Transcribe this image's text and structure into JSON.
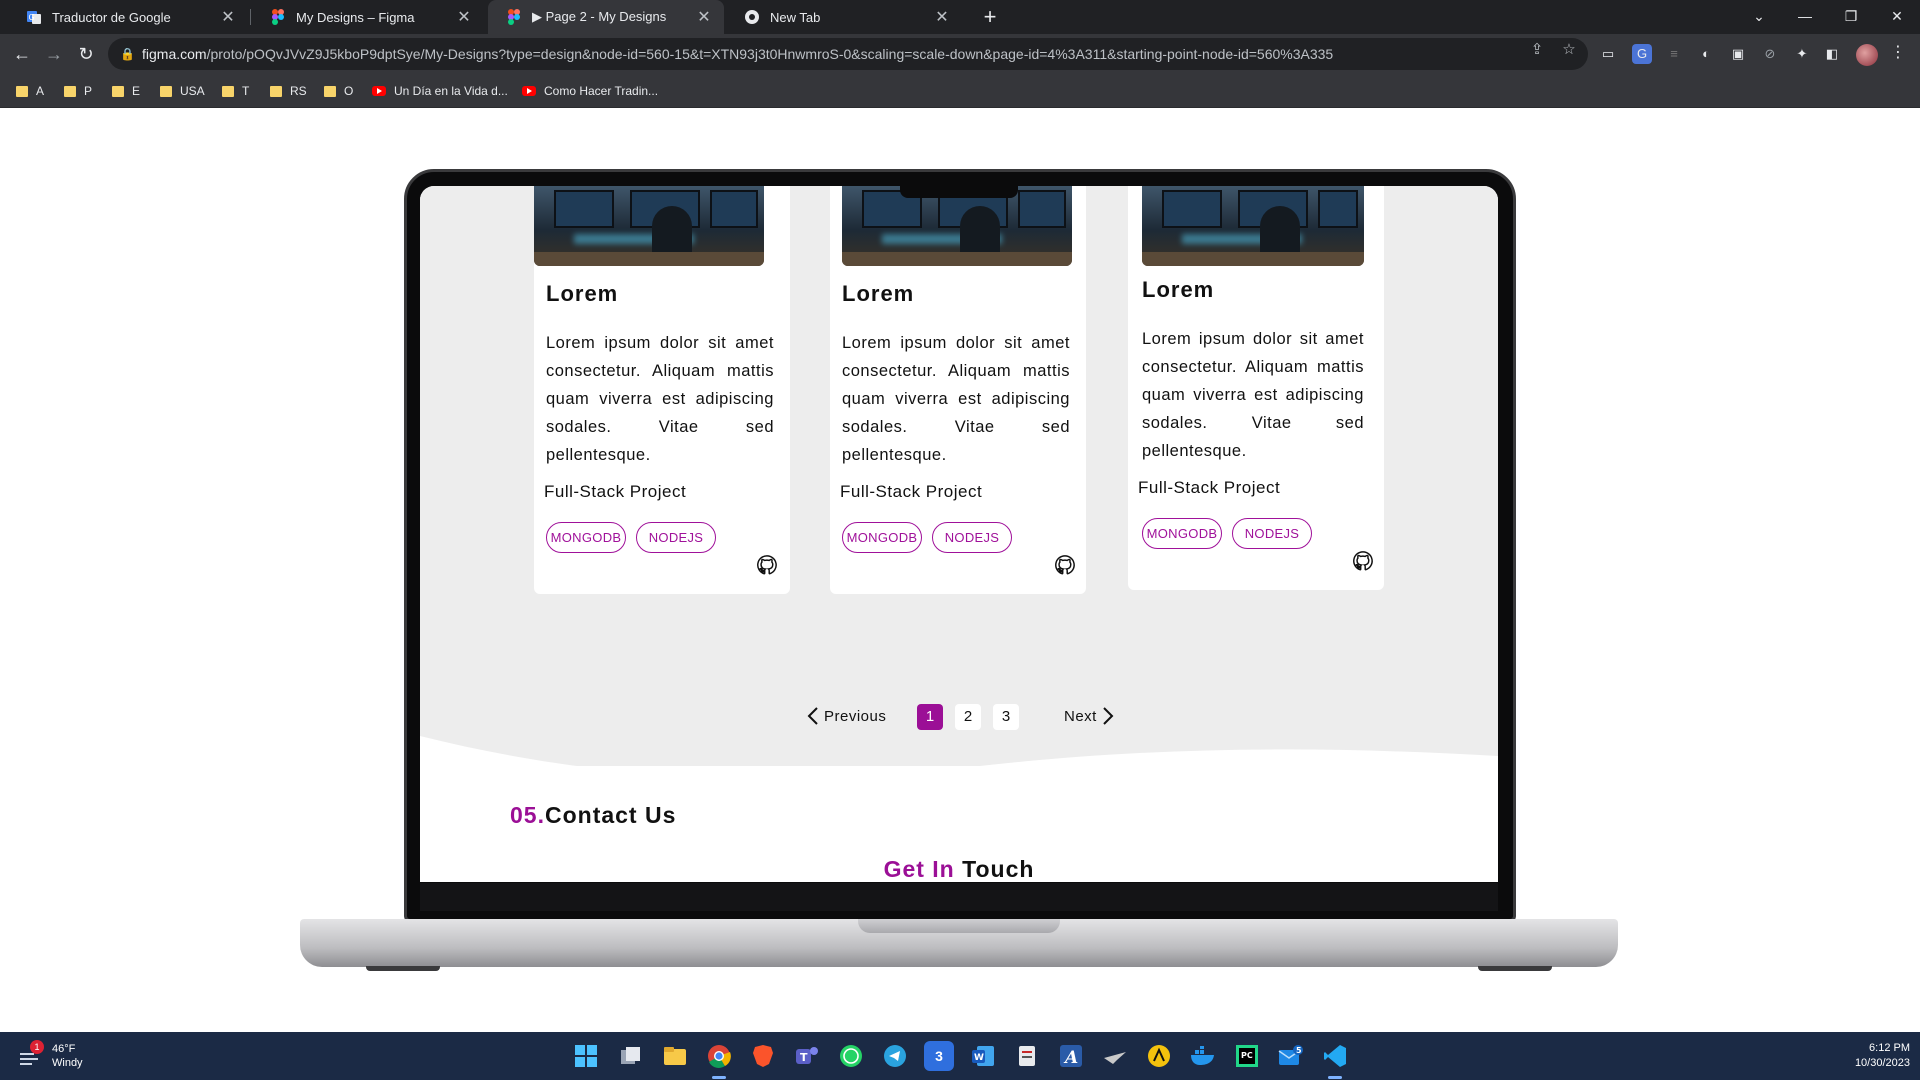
{
  "browser": {
    "tabs": [
      {
        "title": "Traductor de Google",
        "icon": "google-translate-icon",
        "active": false
      },
      {
        "title": "My Designs – Figma",
        "icon": "figma-icon",
        "active": false
      },
      {
        "title": "▶ Page 2 - My Designs",
        "icon": "figma-icon",
        "active": true
      },
      {
        "title": "New Tab",
        "icon": "chrome-icon",
        "active": false
      }
    ],
    "url_host": "figma.com",
    "url_path": "/proto/pOQvJVvZ9J5kboP9dptSye/My-Designs?type=design&node-id=560-15&t=XTN93j3t0HnwmroS-0&scaling=scale-down&page-id=4%3A311&starting-point-node-id=560%3A335",
    "bookmarks": [
      {
        "label": "A",
        "type": "folder"
      },
      {
        "label": "P",
        "type": "folder"
      },
      {
        "label": "E",
        "type": "folder"
      },
      {
        "label": "USA",
        "type": "folder"
      },
      {
        "label": "T",
        "type": "folder"
      },
      {
        "label": "RS",
        "type": "folder"
      },
      {
        "label": "O",
        "type": "folder"
      },
      {
        "label": "Un Día en la Vida d...",
        "type": "youtube"
      },
      {
        "label": "Como Hacer Tradin...",
        "type": "youtube"
      }
    ]
  },
  "page": {
    "projects": [
      {
        "title": "Lorem",
        "description": "Lorem ipsum dolor sit amet consectetur. Aliquam mattis quam viverra est adipiscing sodales. Vitae sed pellentesque.",
        "type": "Full-Stack Project",
        "tags": [
          "MONGODB",
          "NODEJS"
        ]
      },
      {
        "title": "Lorem",
        "description": "Lorem ipsum dolor sit amet consectetur. Aliquam mattis quam viverra est adipiscing sodales. Vitae sed pellentesque.",
        "type": "Full-Stack Project",
        "tags": [
          "MONGODB",
          "NODEJS"
        ]
      },
      {
        "title": "Lorem",
        "description": "Lorem ipsum dolor sit amet consectetur. Aliquam mattis quam viverra est adipiscing sodales. Vitae sed pellentesque.",
        "type": "Full-Stack Project",
        "tags": [
          "MONGODB",
          "NODEJS"
        ]
      }
    ],
    "pagination": {
      "previous": "Previous",
      "next": "Next",
      "pages": [
        "1",
        "2",
        "3"
      ],
      "current": "1"
    },
    "contact": {
      "number": "05.",
      "title": "Contact Us",
      "subtitle_highlight": "Get In",
      "subtitle_rest": "Touch"
    },
    "accent_color": "#9b0f96"
  },
  "taskbar": {
    "weather_temp": "46°F",
    "weather_desc": "Windy",
    "weather_badge": "1",
    "time": "6:12 PM",
    "date": "10/30/2023",
    "apps": [
      "start-icon",
      "task-view-icon",
      "file-explorer-icon",
      "chrome-icon",
      "brave-icon",
      "teams-icon",
      "whatsapp-icon",
      "telegram-icon",
      "app-3-icon",
      "word-icon",
      "notepad-icon",
      "font-app-icon",
      "app-plane-icon",
      "autocad-icon",
      "docker-icon",
      "pycharm-icon",
      "mail-icon",
      "vscode-icon"
    ],
    "mail_badge": "5"
  }
}
